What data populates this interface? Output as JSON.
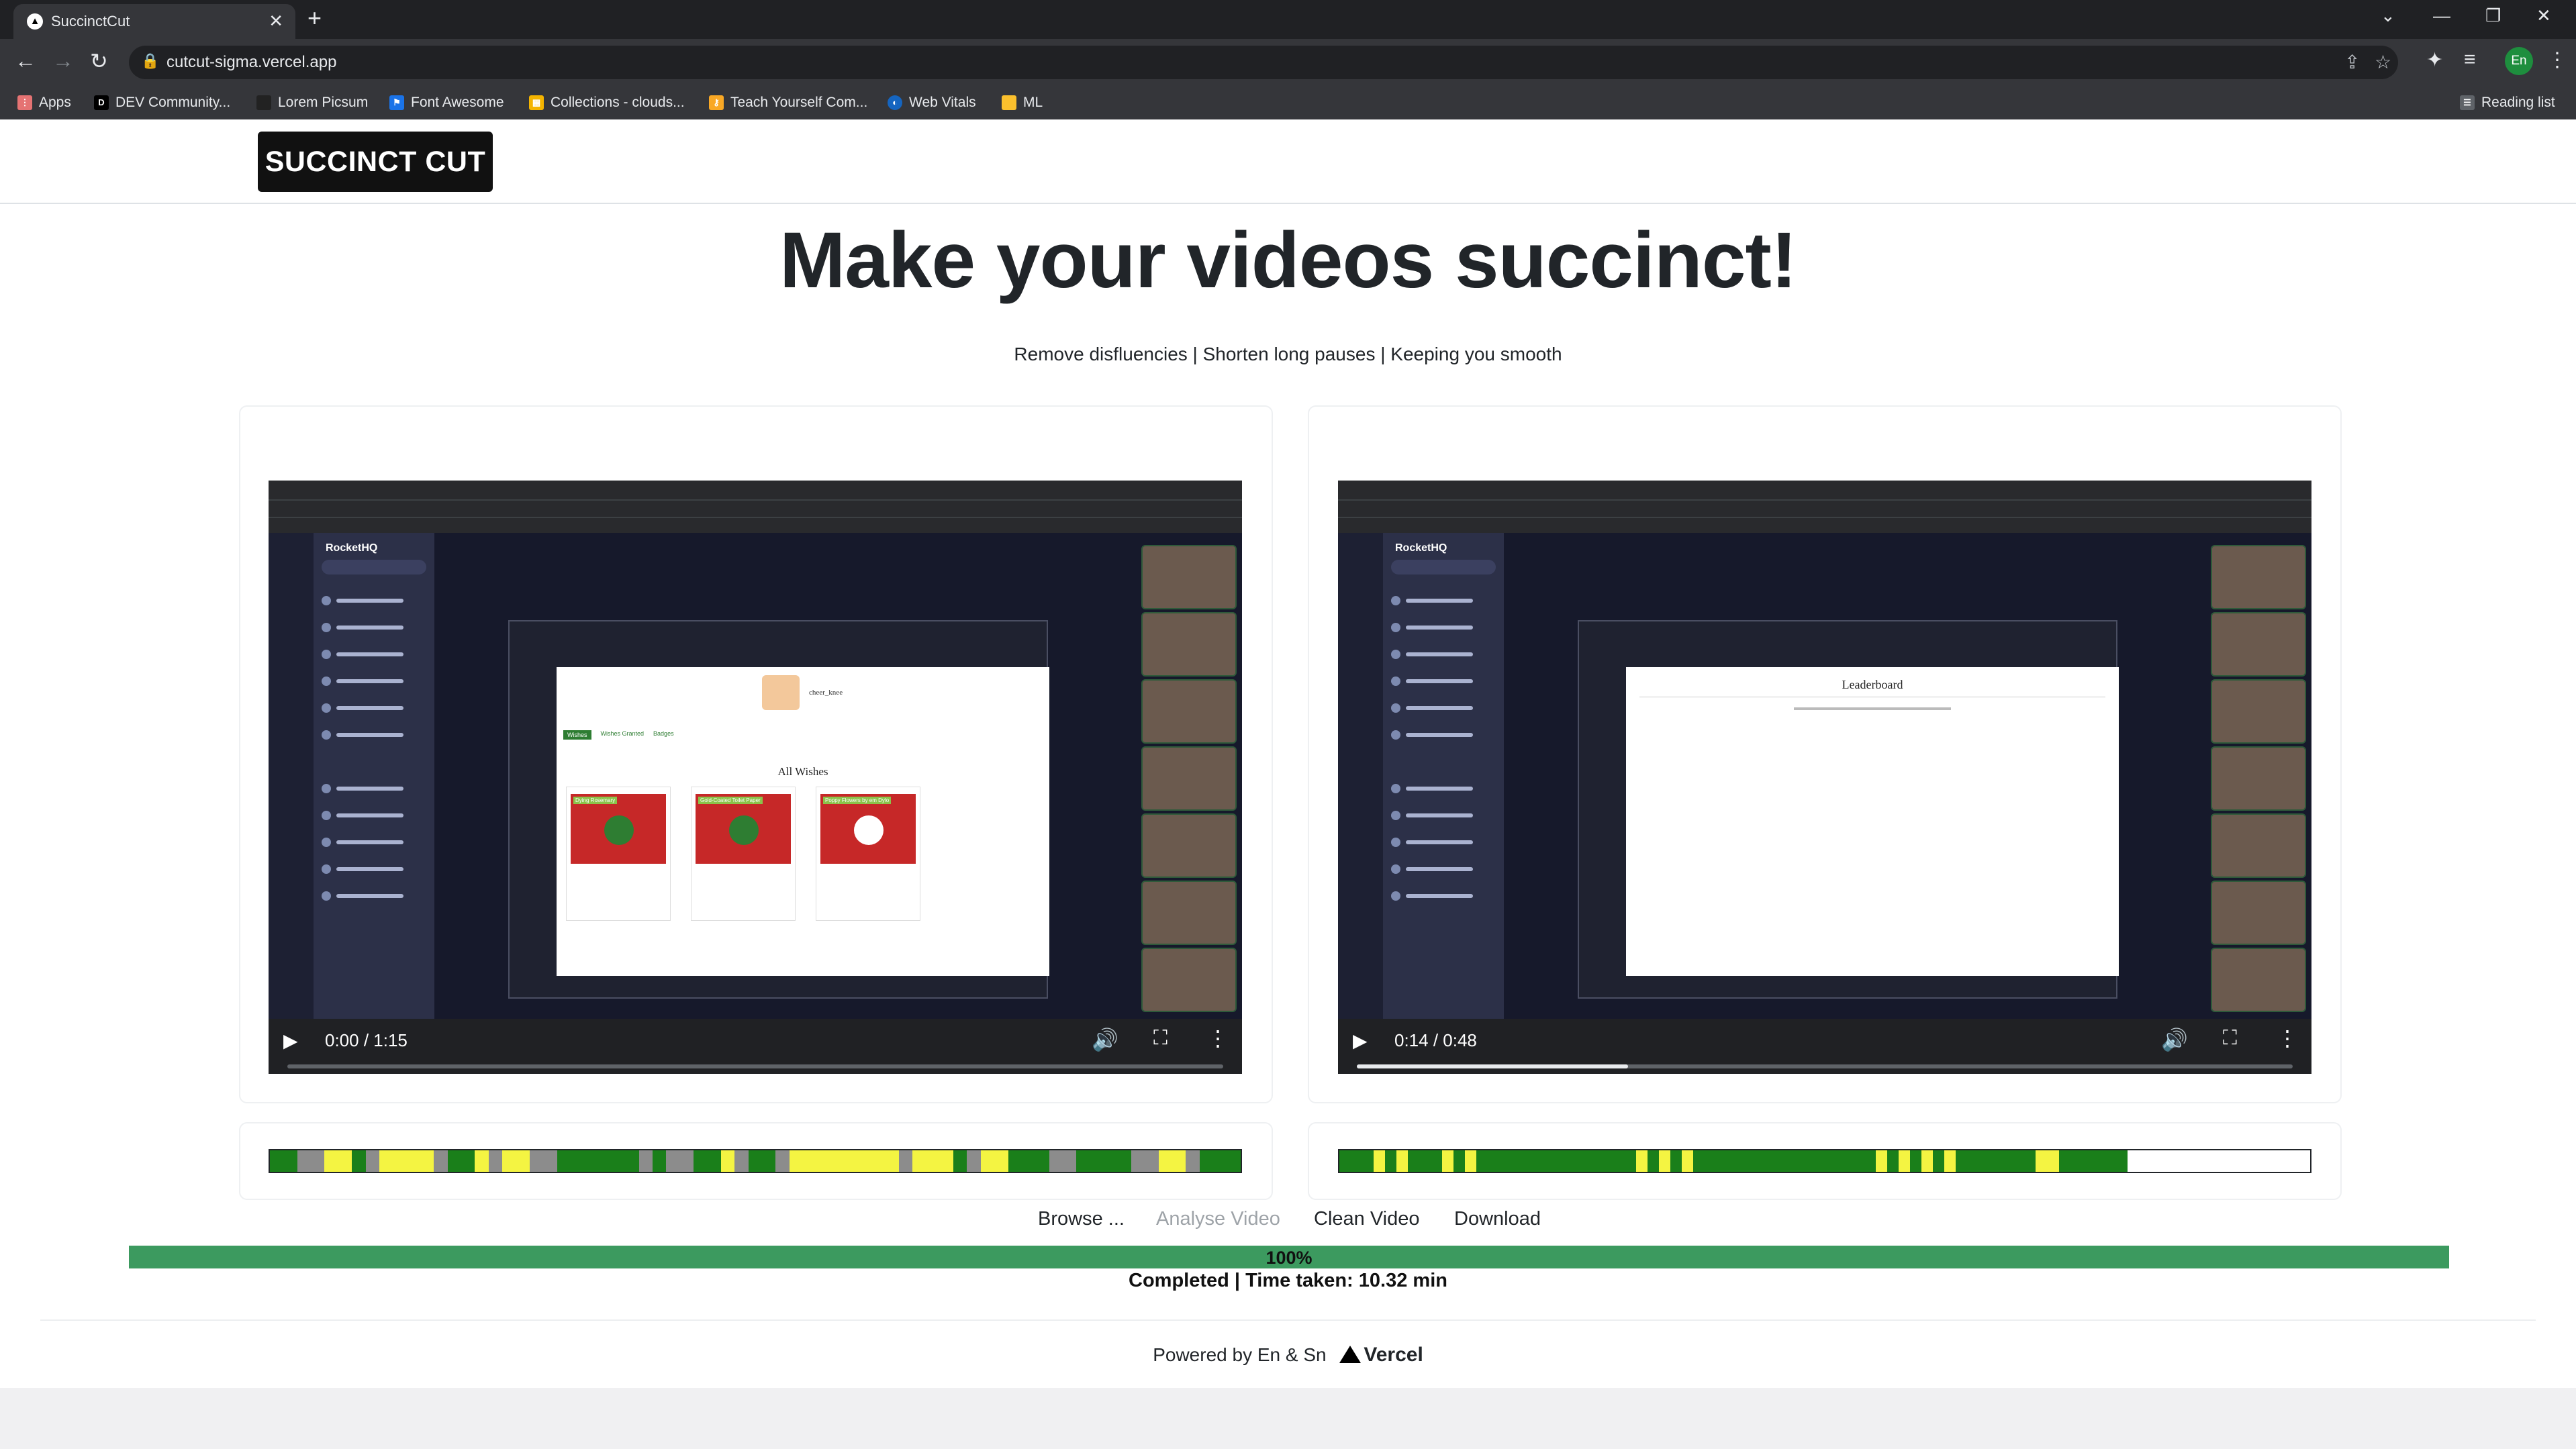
{
  "browser": {
    "tab_title": "SuccinctCut",
    "url": "cutcut-sigma.vercel.app",
    "profile_initials": "En",
    "bookmarks": [
      "Apps",
      "DEV Community...",
      "Lorem Picsum",
      "Font Awesome",
      "Collections - clouds...",
      "Teach Yourself Com...",
      "Web Vitals",
      "ML"
    ],
    "reading_list": "Reading list"
  },
  "navbar": {
    "brand": "SUCCINCT CUT"
  },
  "hero": {
    "title": "Make your videos succinct!",
    "subtitle": "Remove disfluencies | Shorten long pauses | Keeping you smooth"
  },
  "original_video": {
    "time": "0:00 / 1:15",
    "progress": 0.0,
    "screen_inner_title": "All Wishes",
    "screen_user": "cheer_knee",
    "screen_tabs": [
      "Wishes",
      "Wishes Granted",
      "Badges"
    ],
    "gift_titles": [
      "Dying Rosemary",
      "Gold-Coated Toilet Paper",
      "Poppy Flowers by em Dylo"
    ],
    "sidebar_title": "RocketHQ"
  },
  "cut_video": {
    "time": "0:14 / 0:48",
    "progress": 0.29,
    "screen_inner_title": "Leaderboard",
    "sidebar_title": "RocketHQ"
  },
  "timeline_colors": {
    "green": "#1a7f1a",
    "yellow": "#f4f442",
    "gray": "#8c8c8c",
    "empty": "#ffffff"
  },
  "original_timeline": [
    [
      "green",
      2
    ],
    [
      "gray",
      2
    ],
    [
      "yellow",
      2
    ],
    [
      "green",
      1
    ],
    [
      "gray",
      1
    ],
    [
      "yellow",
      4
    ],
    [
      "gray",
      1
    ],
    [
      "green",
      2
    ],
    [
      "yellow",
      1
    ],
    [
      "gray",
      1
    ],
    [
      "yellow",
      2
    ],
    [
      "gray",
      2
    ],
    [
      "green",
      6
    ],
    [
      "gray",
      1
    ],
    [
      "green",
      1
    ],
    [
      "gray",
      2
    ],
    [
      "green",
      2
    ],
    [
      "yellow",
      1
    ],
    [
      "gray",
      1
    ],
    [
      "green",
      2
    ],
    [
      "gray",
      1
    ],
    [
      "yellow",
      8
    ],
    [
      "gray",
      1
    ],
    [
      "yellow",
      3
    ],
    [
      "green",
      1
    ],
    [
      "gray",
      1
    ],
    [
      "yellow",
      2
    ],
    [
      "green",
      3
    ],
    [
      "gray",
      2
    ],
    [
      "green",
      4
    ],
    [
      "gray",
      2
    ],
    [
      "yellow",
      2
    ],
    [
      "gray",
      1
    ],
    [
      "green",
      3
    ]
  ],
  "cut_timeline": [
    [
      "green",
      3
    ],
    [
      "yellow",
      1
    ],
    [
      "green",
      1
    ],
    [
      "yellow",
      1
    ],
    [
      "green",
      3
    ],
    [
      "yellow",
      1
    ],
    [
      "green",
      1
    ],
    [
      "yellow",
      1
    ],
    [
      "green",
      14
    ],
    [
      "yellow",
      1
    ],
    [
      "green",
      1
    ],
    [
      "yellow",
      1
    ],
    [
      "green",
      1
    ],
    [
      "yellow",
      1
    ],
    [
      "green",
      16
    ],
    [
      "yellow",
      1
    ],
    [
      "green",
      1
    ],
    [
      "yellow",
      1
    ],
    [
      "green",
      1
    ],
    [
      "yellow",
      1
    ],
    [
      "green",
      1
    ],
    [
      "yellow",
      1
    ],
    [
      "green",
      7
    ],
    [
      "yellow",
      2
    ],
    [
      "green",
      6
    ],
    [
      "empty",
      16
    ]
  ],
  "actions": {
    "browse": "Browse ...",
    "analyse": "Analyse Video",
    "clean": "Clean Video",
    "download": "Download"
  },
  "progress": {
    "percent": 100,
    "label": "100%"
  },
  "status": "Completed | Time taken: 10.32 min",
  "footer": {
    "powered_by": "Powered by En & Sn",
    "vercel": "Vercel"
  }
}
